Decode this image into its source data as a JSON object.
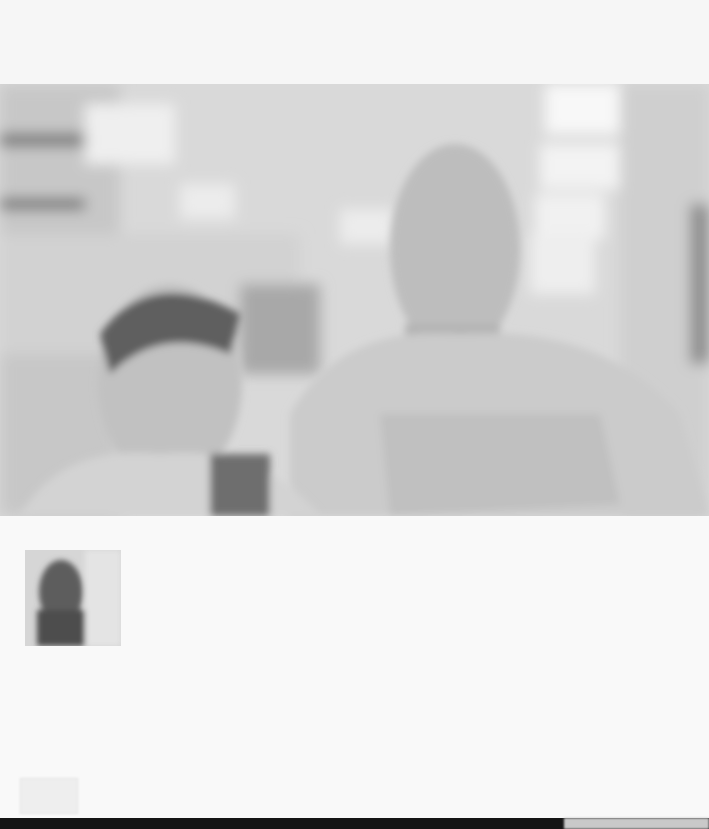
{
  "topbar": {
    "title_words": []
  },
  "profile": {
    "name": "",
    "subtitle": ""
  },
  "caption": {
    "words": []
  },
  "tag": {
    "label": ""
  }
}
